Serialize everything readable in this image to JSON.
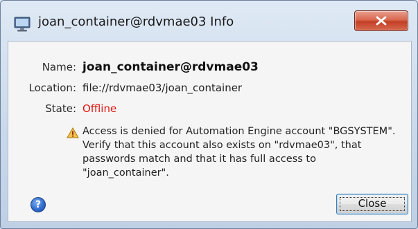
{
  "window": {
    "title": "joan_container@rdvmae03 Info",
    "icon": "monitor-icon",
    "close_icon": "close-x-icon"
  },
  "fields": {
    "name_label": "Name:",
    "name_value": "joan_container@rdvmae03",
    "location_label": "Location:",
    "location_value": "file://rdvmae03/joan_container",
    "state_label": "State:",
    "state_value": "Offline",
    "state_color": "#e0140f"
  },
  "warning": {
    "icon": "warning-icon",
    "message": "Access is denied for Automation Engine account \"BGSYSTEM\".\nVerify that this account also exists on \"rdvmae03\", that\npasswords match and that it has full access to\n\"joan_container\"."
  },
  "footer": {
    "help_icon": "help-icon",
    "help_glyph": "?",
    "close_label": "Close"
  },
  "colors": {
    "accent": "#3c7fb1",
    "close_x": "#c23f25"
  }
}
